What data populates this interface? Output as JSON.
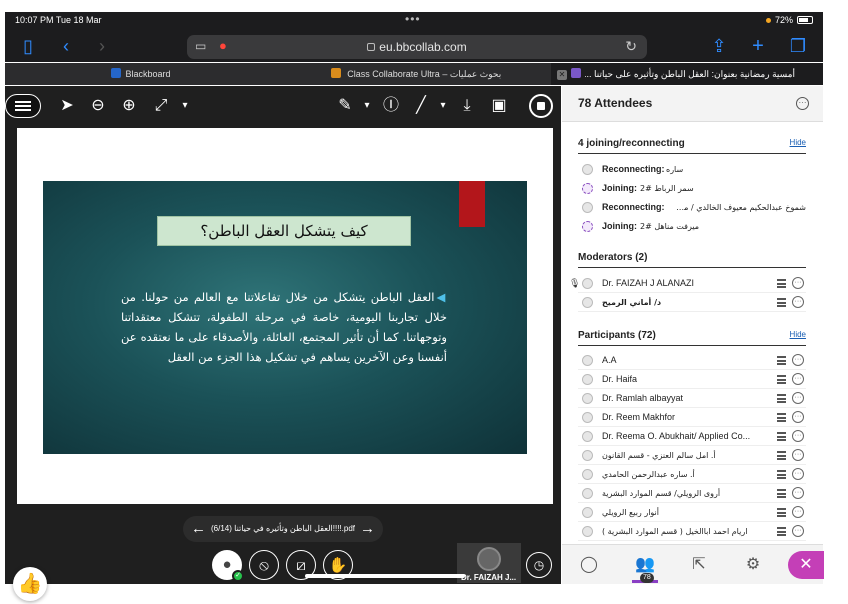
{
  "statusbar": {
    "time": "10:07 PM  Tue 18 Mar",
    "battery": "72%"
  },
  "browser": {
    "url": "eu.bbcollab.com"
  },
  "tabs": [
    {
      "label": "Blackboard",
      "fav_color": "#2566c9"
    },
    {
      "label": "بحوث عمليات – Class Collaborate Ultra",
      "fav_color": "#d98c1c"
    },
    {
      "label": "أمسية رمضانية بعنوان: العقل الباطن وتأثيره على حياتنا ...Cla",
      "fav_color": "#7a58c8"
    }
  ],
  "slide": {
    "title": "كيف يتشكل العقل الباطن؟",
    "body": "العقل الباطن يتشكل من خلال تفاعلاتنا مع العالم من حولنا. من خلال تجاربنا اليومية، خاصة في مرحلة الطفولة، تتشكل معتقداتنا وتوجهاتنا. كما أن تأثير المجتمع، العائلة، والأصدقاء على ما نعتقده عن أنفسنا وعن الآخرين يساهم في تشكيل هذا الجزء من العقل",
    "pager": "(6/14)  العقل الباطن وتأثيره في حياتنا!!!!.pdf"
  },
  "video_tile": {
    "name": "Dr. FAIZAH J..."
  },
  "panel": {
    "title": "78 Attendees",
    "joining": {
      "header": "4 joining/reconnecting",
      "hide": "Hide",
      "rows": [
        {
          "status": "Reconnecting:",
          "name": "ساره"
        },
        {
          "status": "Joining:",
          "name": "سمر الرباط #2"
        },
        {
          "status": "Reconnecting:",
          "name": "شموخ عبدالحكيم معيوف الخالدي / محـ..."
        },
        {
          "status": "Joining:",
          "name": "ميرفت مناهل #2"
        }
      ]
    },
    "moderators": {
      "header": "Moderators (2)",
      "rows": [
        {
          "name": "Dr. FAIZAH J ALANAZI"
        },
        {
          "name": "د/ أماني الرميح"
        }
      ]
    },
    "participants": {
      "header": "Participants (72)",
      "hide": "Hide",
      "rows": [
        {
          "name": "A.A"
        },
        {
          "name": "Dr. Haifa"
        },
        {
          "name": "Dr. Ramlah albayyat"
        },
        {
          "name": "Dr. Reem Makhfor"
        },
        {
          "name": "Dr. Reema O. Abukhait/ Applied Co..."
        },
        {
          "name": "أ. امل سالم العنزي - قسم القانون"
        },
        {
          "name": "أ. ساره عبدالرحمن الحامدي"
        },
        {
          "name": "أروى الرويلي/ قسم الموارد البشرية"
        },
        {
          "name": "أنوار ربيع الرويلي"
        },
        {
          "name": "اريام احمد اباالخيل ( قسم الموارد البشرية )"
        }
      ]
    },
    "footer": {
      "attendee_badge": "78"
    }
  },
  "colors": {
    "accent": "#8a3fc4",
    "close": "#c43fb7",
    "slide_title_bg": "#cde6cf"
  },
  "icons": [
    "sidebar-icon",
    "back-icon",
    "forward-icon",
    "share-icon",
    "new-tab-icon",
    "tabs-icon",
    "pointer-icon",
    "zoom-out-icon",
    "zoom-in-icon",
    "fit-icon",
    "pen-icon",
    "text-icon",
    "line-icon",
    "download-icon",
    "screen-icon",
    "stop-share-icon",
    "chat-icon",
    "attendees-icon",
    "share-content-icon",
    "settings-icon",
    "close-icon",
    "thumbs-up-icon"
  ]
}
